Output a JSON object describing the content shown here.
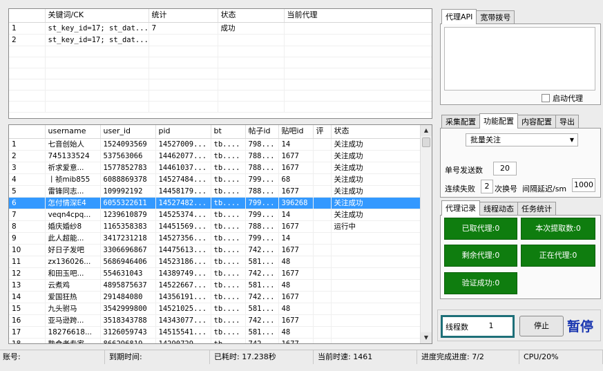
{
  "top_grid": {
    "columns": [
      "关键词/CK",
      "统计",
      "状态",
      "当前代理"
    ],
    "rows": [
      {
        "idx": "1",
        "keyword": "st_key_id=17; st_dat...",
        "count": "7",
        "status": "成功",
        "proxy": ""
      },
      {
        "idx": "2",
        "keyword": "st_key_id=17; st_dat...",
        "count": "",
        "status": "",
        "proxy": ""
      }
    ]
  },
  "main_grid": {
    "columns": [
      "username",
      "user_id",
      "pid",
      "bt",
      "帖子id",
      "贴吧id",
      "评",
      "状态"
    ],
    "selected_row": 5,
    "rows": [
      {
        "idx": "1",
        "username": "七音创始人",
        "user_id": "1524093569",
        "pid": "14527009...",
        "bt": "tb....",
        "tid": "798...",
        "fid": "14",
        "ping": "",
        "status": "关注成功"
      },
      {
        "idx": "2",
        "username": "745133524",
        "user_id": "537563066",
        "pid": "14462077...",
        "bt": "tb....",
        "tid": "788...",
        "fid": "1677",
        "ping": "",
        "status": "关注成功"
      },
      {
        "idx": "3",
        "username": "祈求爱意...",
        "user_id": "1577852783",
        "pid": "14461037...",
        "bt": "tb....",
        "tid": "788...",
        "fid": "1677",
        "ping": "",
        "status": "关注成功"
      },
      {
        "idx": "4",
        "username": "丨祯mib855",
        "user_id": "6088869378",
        "pid": "14527484...",
        "bt": "tb....",
        "tid": "799...",
        "fid": "68",
        "ping": "",
        "status": "关注成功"
      },
      {
        "idx": "5",
        "username": "雷锋同志...",
        "user_id": "109992192",
        "pid": "14458179...",
        "bt": "tb....",
        "tid": "788...",
        "fid": "1677",
        "ping": "",
        "status": "关注成功"
      },
      {
        "idx": "6",
        "username": "怎付情深E4",
        "user_id": "6055322611",
        "pid": "14527482...",
        "bt": "tb....",
        "tid": "799...",
        "fid": "396268",
        "ping": "",
        "status": "关注成功"
      },
      {
        "idx": "7",
        "username": "veqn4cpq...",
        "user_id": "1239610879",
        "pid": "14525374...",
        "bt": "tb....",
        "tid": "799...",
        "fid": "14",
        "ping": "",
        "status": "关注成功"
      },
      {
        "idx": "8",
        "username": "婚庆婚纱8",
        "user_id": "1165358383",
        "pid": "14451569...",
        "bt": "tb....",
        "tid": "788...",
        "fid": "1677",
        "ping": "",
        "status": "运行中"
      },
      {
        "idx": "9",
        "username": "此人超能...",
        "user_id": "3417231218",
        "pid": "14527356...",
        "bt": "tb....",
        "tid": "799...",
        "fid": "14",
        "ping": "",
        "status": ""
      },
      {
        "idx": "10",
        "username": "好日子发吧",
        "user_id": "3306696867",
        "pid": "14475613...",
        "bt": "tb....",
        "tid": "742...",
        "fid": "1677",
        "ping": "",
        "status": ""
      },
      {
        "idx": "11",
        "username": "zx136026...",
        "user_id": "5686946406",
        "pid": "14523186...",
        "bt": "tb....",
        "tid": "581...",
        "fid": "48",
        "ping": "",
        "status": ""
      },
      {
        "idx": "12",
        "username": "和田玉吧...",
        "user_id": "554631043",
        "pid": "14389749...",
        "bt": "tb....",
        "tid": "742...",
        "fid": "1677",
        "ping": "",
        "status": ""
      },
      {
        "idx": "13",
        "username": "云煮鸡",
        "user_id": "4895875637",
        "pid": "14522667...",
        "bt": "tb....",
        "tid": "581...",
        "fid": "48",
        "ping": "",
        "status": ""
      },
      {
        "idx": "14",
        "username": "爱国狂热",
        "user_id": "291484080",
        "pid": "14356191...",
        "bt": "tb....",
        "tid": "742...",
        "fid": "1677",
        "ping": "",
        "status": ""
      },
      {
        "idx": "15",
        "username": "九头驸马",
        "user_id": "3542999800",
        "pid": "14521025...",
        "bt": "tb....",
        "tid": "581...",
        "fid": "48",
        "ping": "",
        "status": ""
      },
      {
        "idx": "16",
        "username": "亚马逊跨...",
        "user_id": "3518343788",
        "pid": "14343077...",
        "bt": "tb....",
        "tid": "742...",
        "fid": "1677",
        "ping": "",
        "status": ""
      },
      {
        "idx": "17",
        "username": "18276618...",
        "user_id": "3126059743",
        "pid": "14515541...",
        "bt": "tb....",
        "tid": "581...",
        "fid": "48",
        "ping": "",
        "status": ""
      },
      {
        "idx": "18",
        "username": "熟食老专家",
        "user_id": "866296819",
        "pid": "14290729...",
        "bt": "tb....",
        "tid": "742...",
        "fid": "1677",
        "ping": "",
        "status": ""
      }
    ]
  },
  "proxy_panel": {
    "tabs": [
      "代理API",
      "宽带拨号"
    ],
    "active_tab": 0,
    "api_text": "",
    "enable_label": "启动代理",
    "enable_checked": false
  },
  "config_panel": {
    "tabs": [
      "采集配置",
      "功能配置",
      "内容配置",
      "导出"
    ],
    "active_tab": 1,
    "mode": "批量关注",
    "per_account_label": "单号发送数",
    "per_account_value": "20",
    "fail_label": "连续失败",
    "fail_value": "2",
    "switch_label": "次换号",
    "interval_label": "间隔延迟/sm",
    "interval_value": "1000"
  },
  "stats_panel": {
    "tabs": [
      "代理记录",
      "线程动态",
      "任务统计"
    ],
    "active_tab": 0,
    "buttons": {
      "got_proxy": "已取代理:0",
      "this_got": "本次提取数:0",
      "remain_proxy": "剩余代理:0",
      "in_use_proxy": "正在代理:0",
      "verify_ok": "验证成功:0"
    }
  },
  "controls": {
    "threads_label": "线程数",
    "threads_value": "1",
    "stop_label": "停止",
    "pause_label": "暂停"
  },
  "status_bar": {
    "account": "账号:",
    "expire": "到期时间:",
    "elapsed": "已耗时: 17.238秒",
    "speed": "当前时速: 1461",
    "progress": "进度完成进度: 7/2",
    "cpu": "CPU/20%"
  },
  "colors": {
    "selection": "#3399ff",
    "green_button": "#0f7d0f",
    "pause_text": "#1a36b0",
    "threads_border": "#1d6f78"
  }
}
